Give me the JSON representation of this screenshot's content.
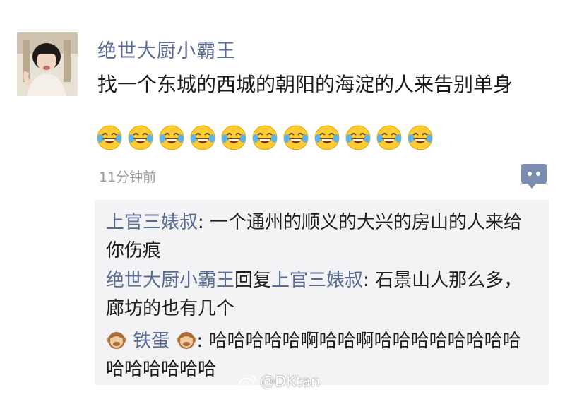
{
  "post": {
    "username": "绝世大厨小霸王",
    "text": "找一个东城的西城的朝阳的海淀的人来告别单身",
    "emoji_count": 11,
    "emoji_icon": "tears-of-joy-icon",
    "time": "11分钟前"
  },
  "comments": [
    {
      "author": "上官三婊叔",
      "separator": ": ",
      "text": "一个通州的顺义的大兴的房山的人来给你伤痕"
    },
    {
      "author": "绝世大厨小霸王",
      "reply_word": "回复",
      "reply_to": "上官三婊叔",
      "separator": ": ",
      "text": "石景山人那么多，廊坊的也有几个"
    },
    {
      "author": "铁蛋",
      "separator": ": ",
      "text": "哈哈哈哈哈啊哈哈啊哈哈哈哈哈哈哈哈哈哈哈哈哈哈"
    }
  ],
  "watermark": {
    "text": "@DKtan"
  },
  "colors": {
    "link": "#5a6b93",
    "comment_bg": "#f3f3f5",
    "time": "#9a9a9a",
    "comment_button": "#7b8db0"
  }
}
